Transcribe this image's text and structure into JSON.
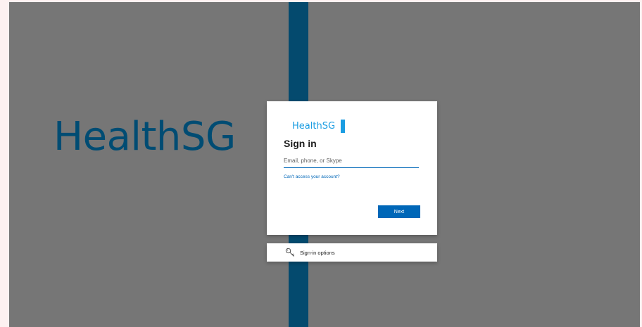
{
  "background": {
    "brand_text": "HealthSG",
    "backdrop_color": "#767676",
    "stripe_color": "#044a6e",
    "brand_color": "#004c73"
  },
  "signin": {
    "logo_text": "HealthSG",
    "logo_color": "#1b9de2",
    "title": "Sign in",
    "email_placeholder": "Email, phone, or Skype",
    "email_value": "",
    "access_link": "Can't access your account?",
    "next_label": "Next",
    "accent_color": "#0067b8"
  },
  "options": {
    "icon": "key-icon",
    "label": "Sign-in options"
  }
}
